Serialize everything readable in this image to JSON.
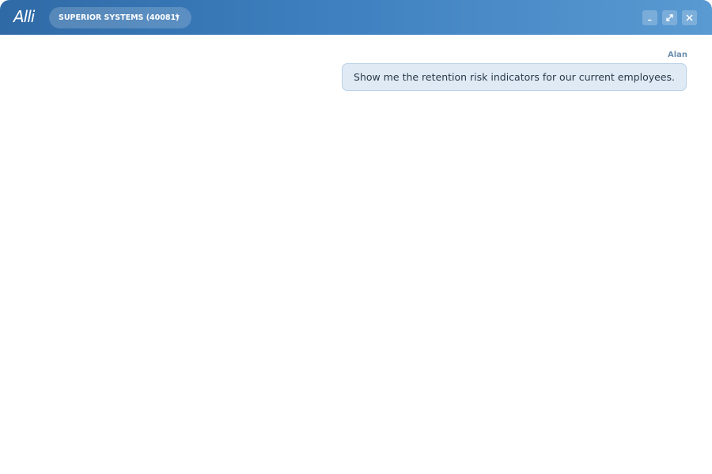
{
  "app": {
    "logo_text": "Alli"
  },
  "header": {
    "org_selector_label": "SUPERIOR SYSTEMS (40081)",
    "window_controls": {
      "minimize_icon": "minimize-icon",
      "maximize_icon": "expand-icon",
      "close_icon": "close-icon"
    }
  },
  "conversation": {
    "messages": [
      {
        "sender": "Alan",
        "text": "Show me the retention risk indicators for our current employees."
      }
    ]
  },
  "colors": {
    "titlebar_start": "#2f6aa6",
    "titlebar_end": "#5a9ad2",
    "bubble_background": "#dfeaf4",
    "bubble_border": "#b9d2e8",
    "sender_name": "#6f8fae"
  }
}
